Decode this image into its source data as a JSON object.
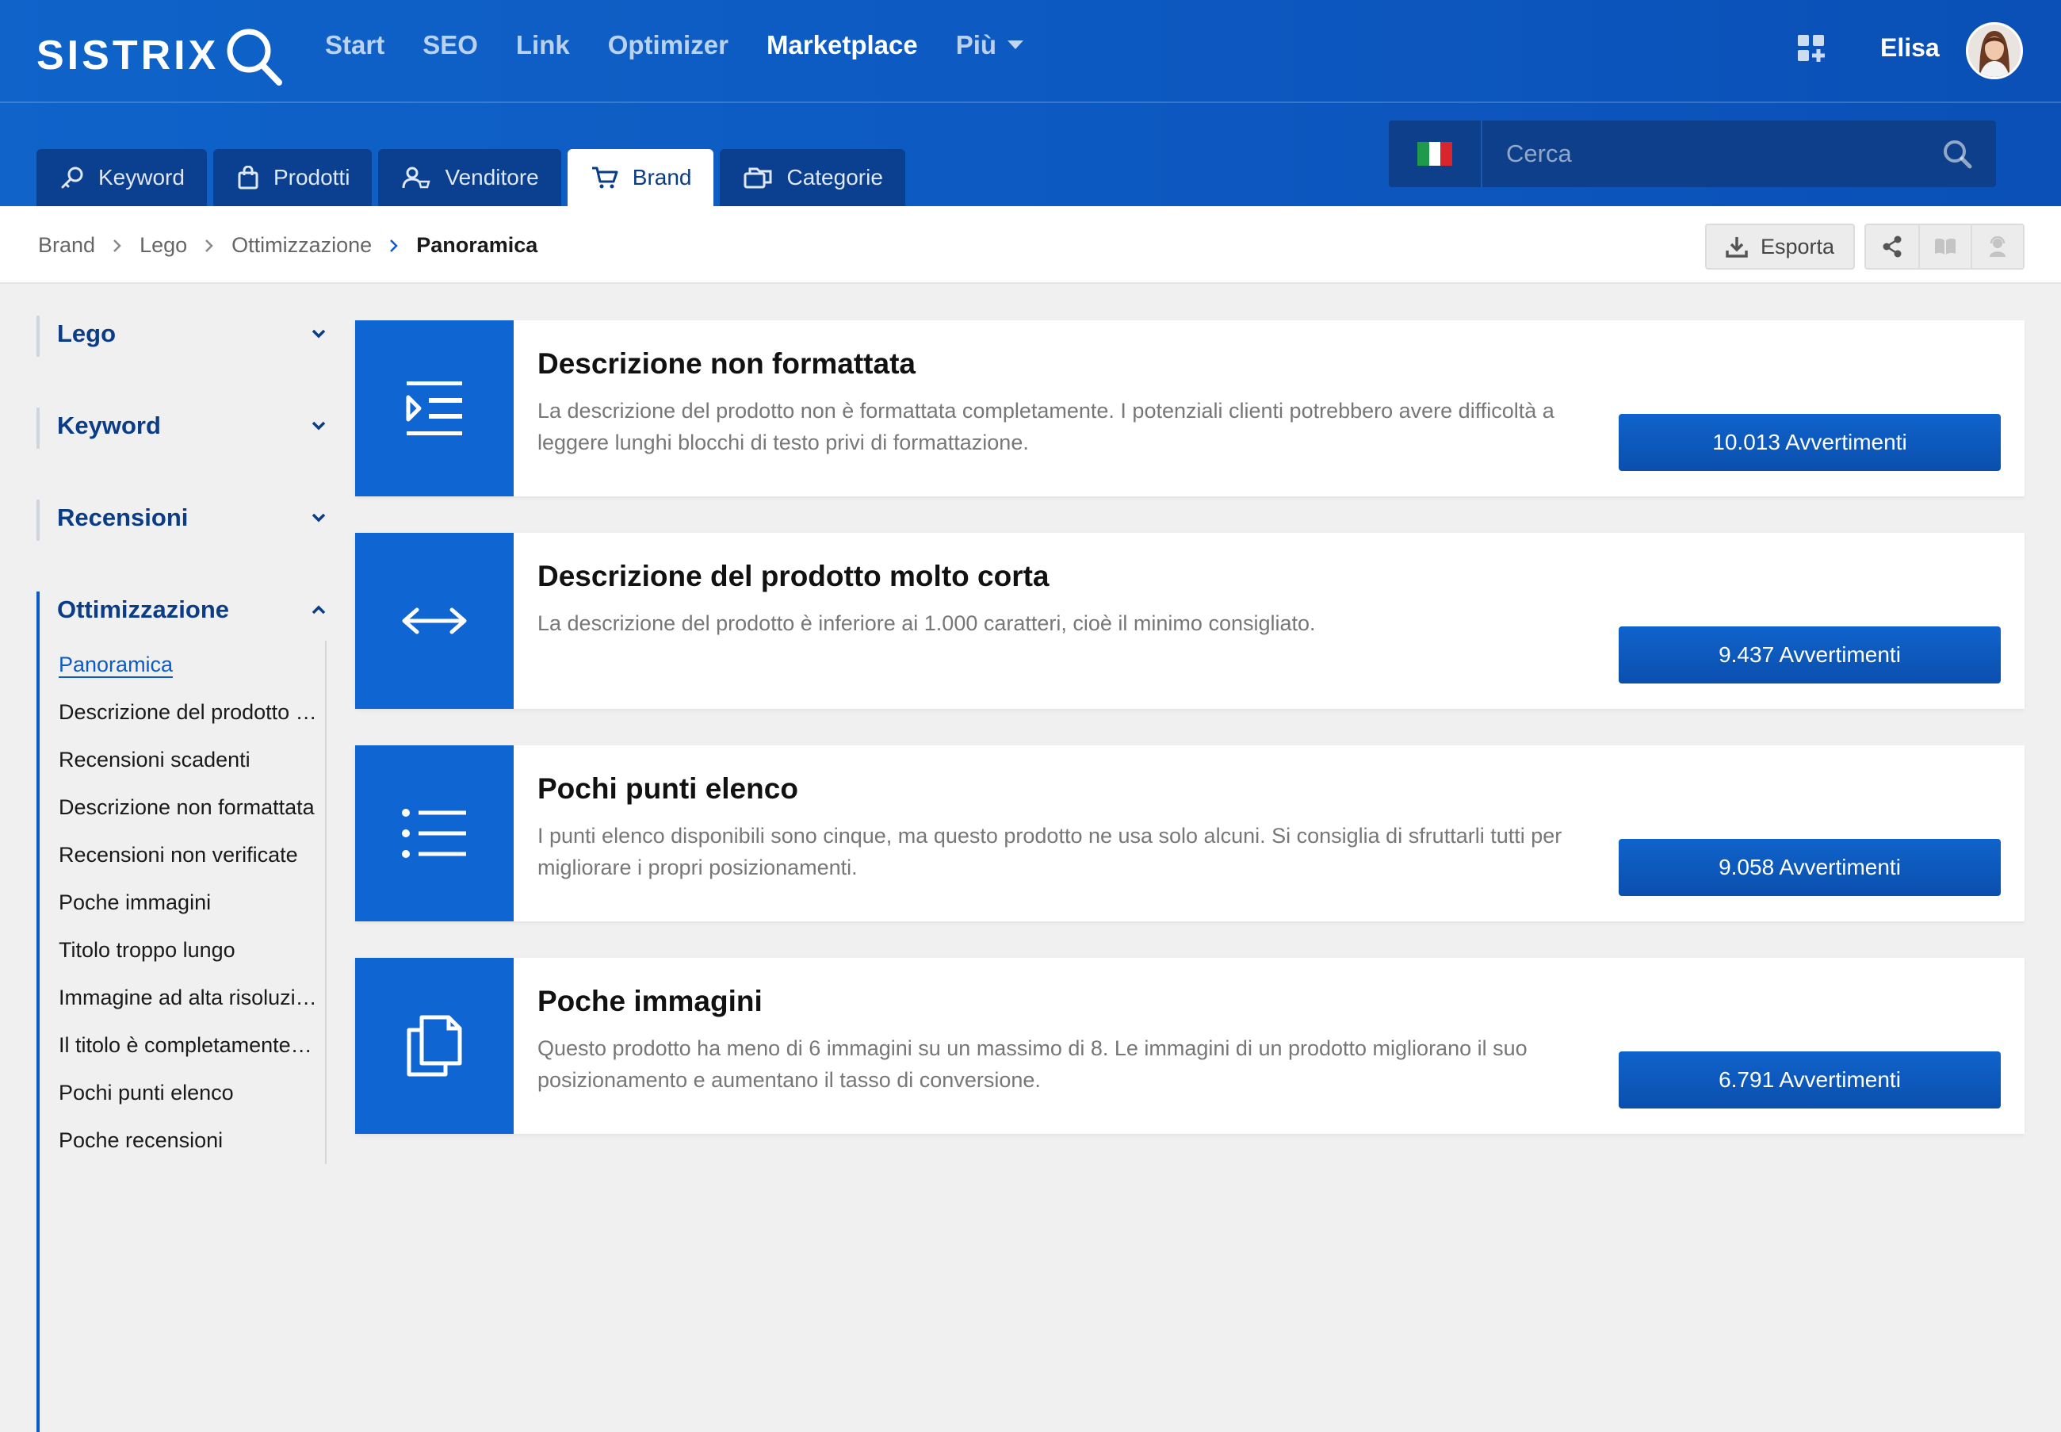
{
  "header": {
    "logo": "SISTRIX",
    "nav": [
      "Start",
      "SEO",
      "Link",
      "Optimizer",
      "Marketplace",
      "Più"
    ],
    "active_nav": "Marketplace",
    "user_name": "Elisa"
  },
  "tabs": [
    {
      "label": "Keyword",
      "icon": "key-icon"
    },
    {
      "label": "Prodotti",
      "icon": "bag-icon"
    },
    {
      "label": "Venditore",
      "icon": "seller-icon"
    },
    {
      "label": "Brand",
      "icon": "cart-icon"
    },
    {
      "label": "Categorie",
      "icon": "folders-icon"
    }
  ],
  "active_tab": "Brand",
  "search": {
    "placeholder": "Cerca",
    "country_flag": "italy-flag"
  },
  "breadcrumb": [
    "Brand",
    "Lego",
    "Ottimizzazione",
    "Panoramica"
  ],
  "actions": {
    "export_label": "Esporta"
  },
  "sidebar": {
    "sections": [
      {
        "title": "Lego"
      },
      {
        "title": "Keyword"
      },
      {
        "title": "Recensioni"
      },
      {
        "title": "Ottimizzazione"
      }
    ],
    "items": [
      "Panoramica",
      "Descrizione del prodotto molto corta",
      "Recensioni scadenti",
      "Descrizione non formattata",
      "Recensioni non verificate",
      "Poche immagini",
      "Titolo troppo lungo",
      "Immagine ad alta risoluzione mancante",
      "Il titolo è completamente in maiuscolo",
      "Pochi punti elenco",
      "Poche recensioni"
    ]
  },
  "cards": [
    {
      "title": "Descrizione non formattata",
      "description": "La descrizione del prodotto non è formattata completamente. I potenziali clienti potrebbero avere difficoltà a leggere lunghi blocchi di testo privi di formattazione.",
      "button": "10.013 Avvertimenti",
      "icon": "text-format-icon"
    },
    {
      "title": "Descrizione del prodotto molto corta",
      "description": "La descrizione del prodotto è inferiore ai 1.000 caratteri, cioè il minimo consigliato.",
      "button": "9.437 Avvertimenti",
      "icon": "arrows-horizontal-icon"
    },
    {
      "title": "Pochi punti elenco",
      "description": "I punti elenco disponibili sono cinque, ma questo prodotto ne usa solo alcuni. Si consiglia di sfruttarli tutti per migliorare i propri posizionamenti.",
      "button": "9.058 Avvertimenti",
      "icon": "list-icon"
    },
    {
      "title": "Poche immagini",
      "description": "Questo prodotto ha meno di 6 immagini su un massimo di 8. Le immagini di un prodotto migliorano il suo posizionamento e aumentano il tasso di conversione.",
      "button": "6.791 Avvertimenti",
      "icon": "copy-icon"
    }
  ],
  "colors": {
    "brand_blue": "#0f66d2",
    "header_blue": "#0c58c0",
    "tab_dark": "#0b3f8f",
    "nav_title": "#0b3c87"
  }
}
